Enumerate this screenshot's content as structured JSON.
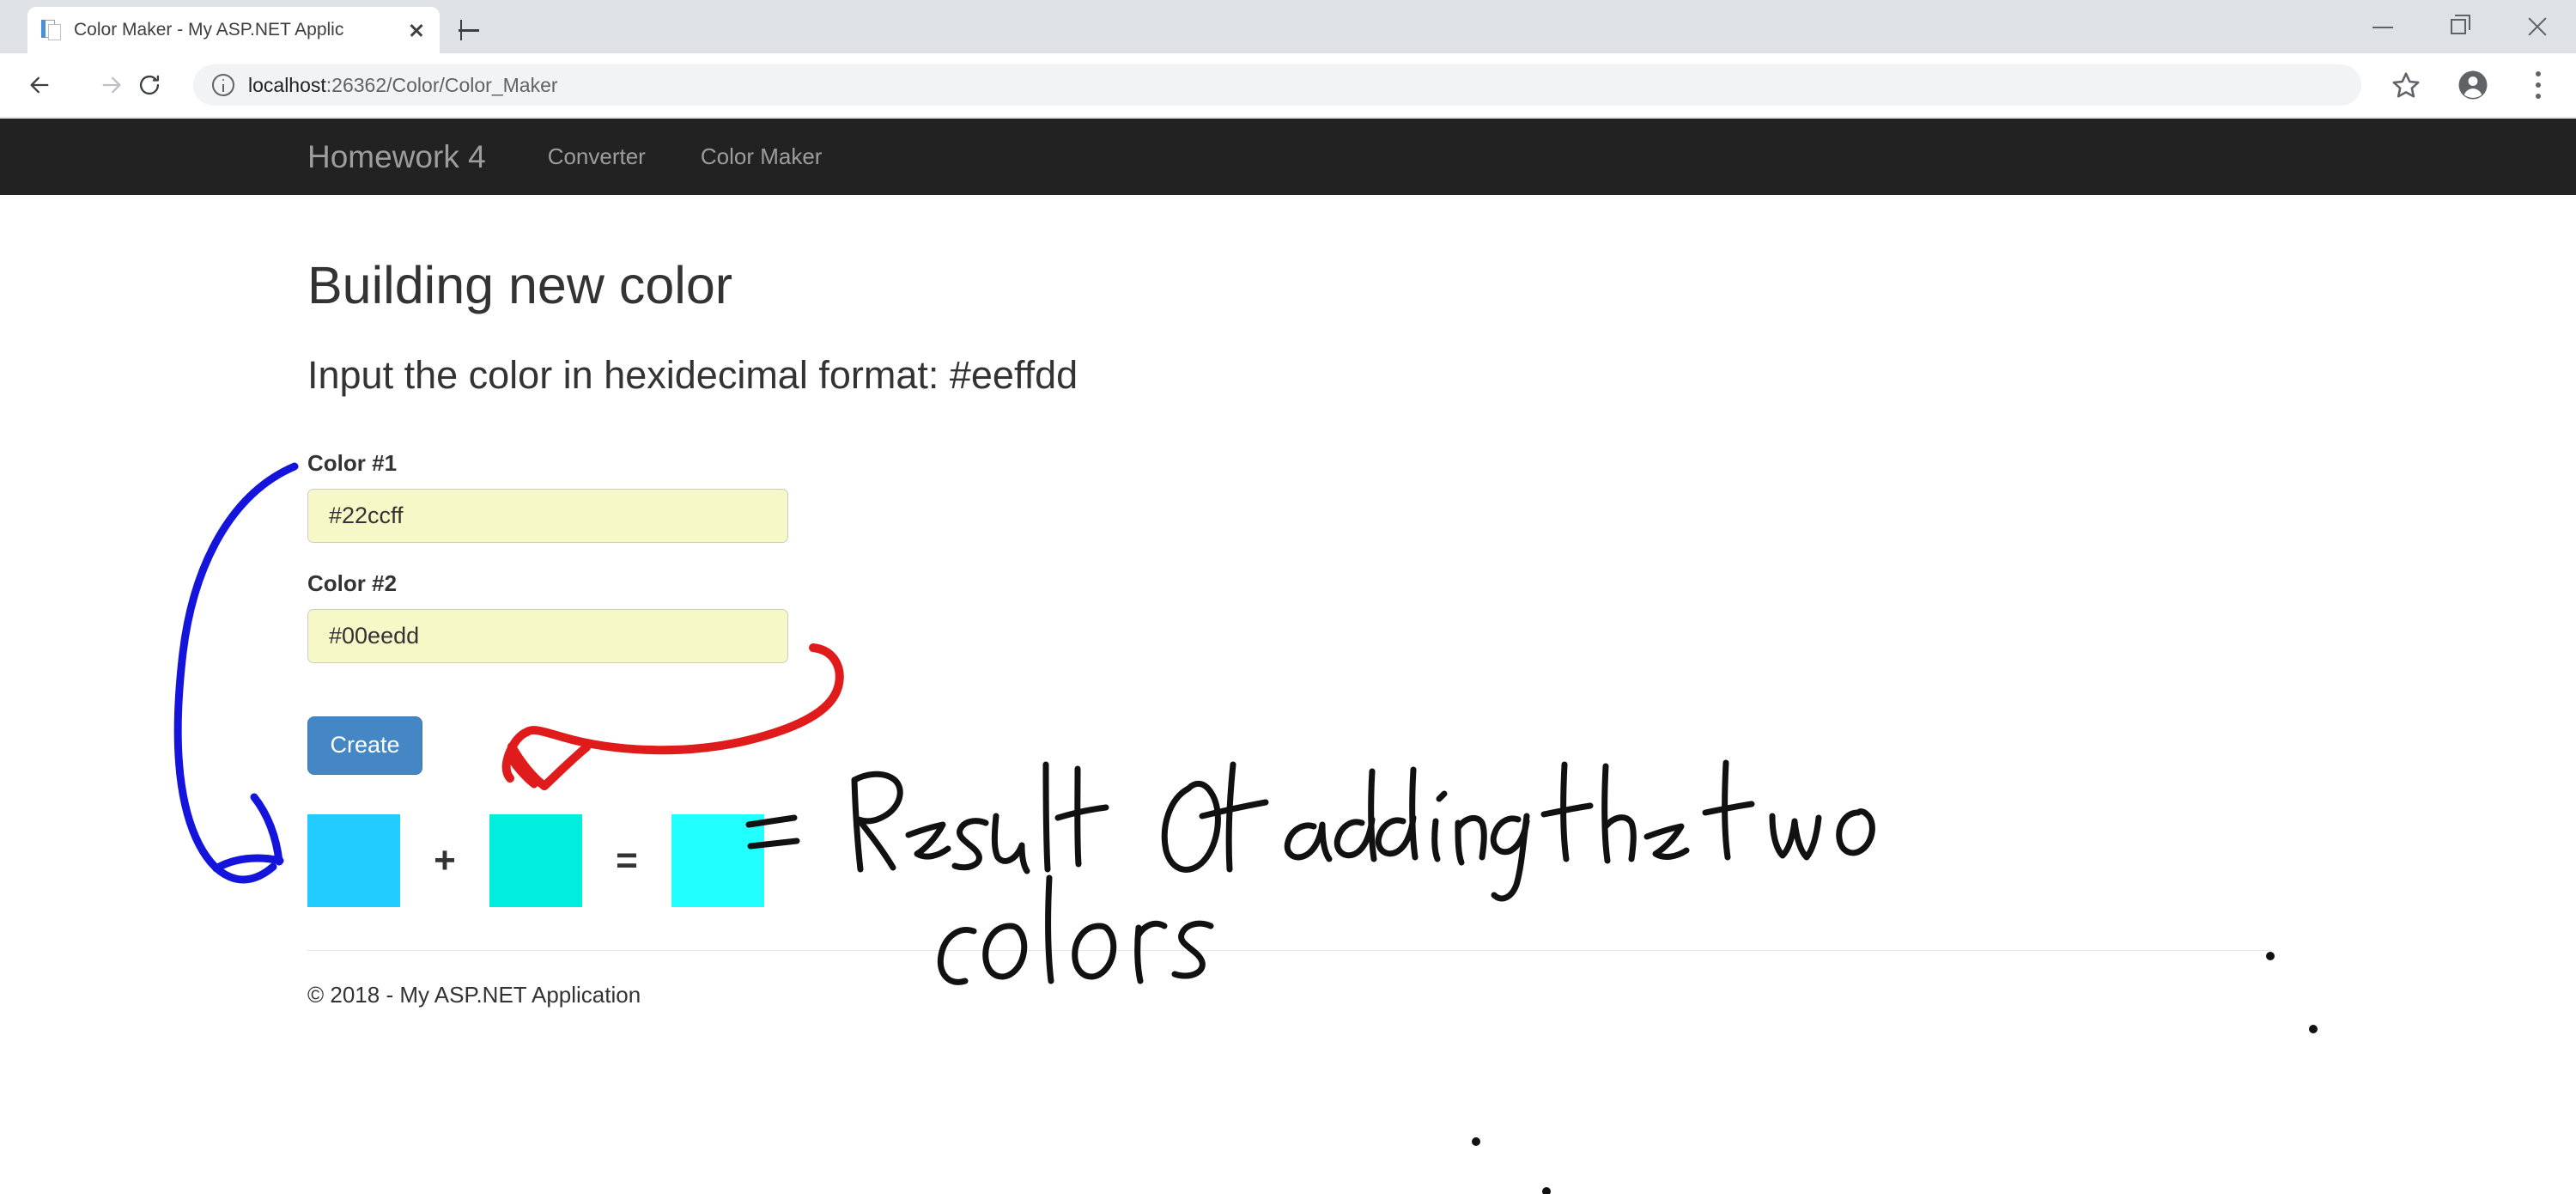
{
  "browser": {
    "tab": {
      "title": "Color Maker - My ASP.NET Applic",
      "favicon_icon": "page-document-icon",
      "close_icon": "close-icon"
    },
    "new_tab_icon": "plus-icon",
    "window_controls": {
      "minimize_icon": "minimize-icon",
      "maximize_icon": "restore-window-icon",
      "close_icon": "close-icon"
    },
    "toolbar": {
      "back_icon": "arrow-left-icon",
      "forward_icon": "arrow-right-icon",
      "reload_icon": "reload-icon",
      "site_info_icon": "info-circle-icon",
      "url_host": "localhost",
      "url_rest": ":26362/Color/Color_Maker",
      "url_full": "localhost:26362/Color/Color_Maker",
      "bookmark_icon": "star-icon",
      "profile_icon": "avatar-icon",
      "menu_icon": "three-dot-menu-icon"
    }
  },
  "navbar": {
    "brand": "Homework 4",
    "links": [
      {
        "label": "Converter"
      },
      {
        "label": "Color Maker"
      }
    ],
    "background": "#222222",
    "link_color": "#9d9d9d"
  },
  "main": {
    "title": "Building new color",
    "subtitle": "Input the color in hexidecimal format: #eeffdd",
    "fields": [
      {
        "label": "Color #1",
        "value": "#22ccff",
        "placeholder": "",
        "background": "#f7f8c8"
      },
      {
        "label": "Color #2",
        "value": "#00eedd",
        "placeholder": "",
        "background": "#f7f8c8"
      }
    ],
    "create_button": {
      "label": "Create",
      "background": "#4587c4"
    },
    "result": {
      "operator_plus": "+",
      "operator_equals": "=",
      "swatches": [
        {
          "name": "color-1-swatch",
          "color": "#22ccff"
        },
        {
          "name": "color-2-swatch",
          "color": "#00eedd"
        },
        {
          "name": "result-swatch",
          "color": "#22ffff"
        }
      ]
    }
  },
  "footer": {
    "text": "© 2018 - My ASP.NET Application"
  },
  "annotations": {
    "handwriting": {
      "line1": "= Result Of adding the two",
      "line2": "colors",
      "ink_color": "#000000"
    },
    "blue_arrow": {
      "color": "#1414dc",
      "description": "curve from Color #1 input to first color swatch"
    },
    "red_arrow": {
      "color": "#e01b1b",
      "description": "curve from Color #2 input to the swatch row"
    }
  }
}
